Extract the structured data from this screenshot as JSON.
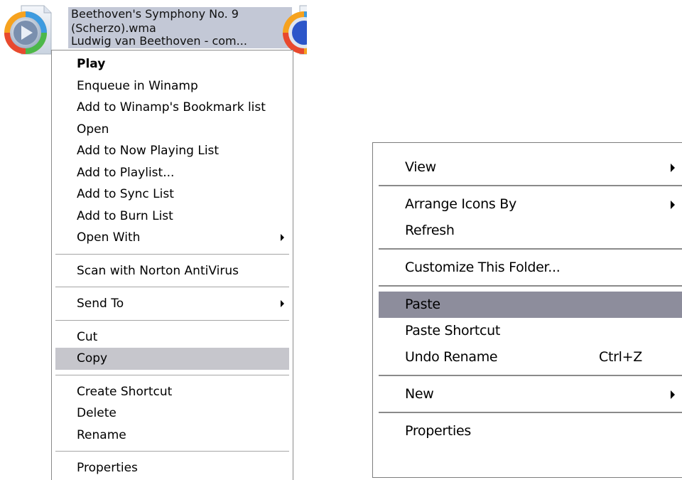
{
  "desktop": {
    "file_caption": {
      "line1": "Beethoven's Symphony No. 9",
      "line2": "(Scherzo).wma",
      "line3_partial": "Ludwig van Beethoven - com..."
    }
  },
  "left_menu": {
    "groups": [
      [
        {
          "label": "Play",
          "bold": true
        },
        {
          "label": "Enqueue in Winamp"
        },
        {
          "label": "Add to Winamp's Bookmark list"
        },
        {
          "label": "Open"
        },
        {
          "label": "Add to Now Playing List"
        },
        {
          "label": "Add to Playlist..."
        },
        {
          "label": "Add to Sync List"
        },
        {
          "label": "Add to Burn List"
        },
        {
          "label": "Open With",
          "submenu": true
        }
      ],
      [
        {
          "label": "Scan with Norton AntiVirus"
        }
      ],
      [
        {
          "label": "Send To",
          "submenu": true
        }
      ],
      [
        {
          "label": "Cut"
        },
        {
          "label": "Copy",
          "selected": true
        }
      ],
      [
        {
          "label": "Create Shortcut"
        },
        {
          "label": "Delete"
        },
        {
          "label": "Rename"
        }
      ],
      [
        {
          "label": "Properties"
        }
      ]
    ]
  },
  "right_menu": {
    "items": {
      "view": "View",
      "arrange_icons_by": "Arrange Icons By",
      "refresh": "Refresh",
      "customize_folder": "Customize This Folder...",
      "paste": "Paste",
      "paste_shortcut": "Paste Shortcut",
      "undo_rename": "Undo Rename",
      "undo_rename_shortcut": "Ctrl+Z",
      "new": "New",
      "properties": "Properties"
    }
  },
  "colors": {
    "left_selection": "#c6c6cc",
    "right_selection": "#8d8d9c",
    "caption_highlight": "#c3c8d6"
  },
  "icons": [
    "windows-media-audio-file-icon",
    "submenu-arrow-icon"
  ]
}
